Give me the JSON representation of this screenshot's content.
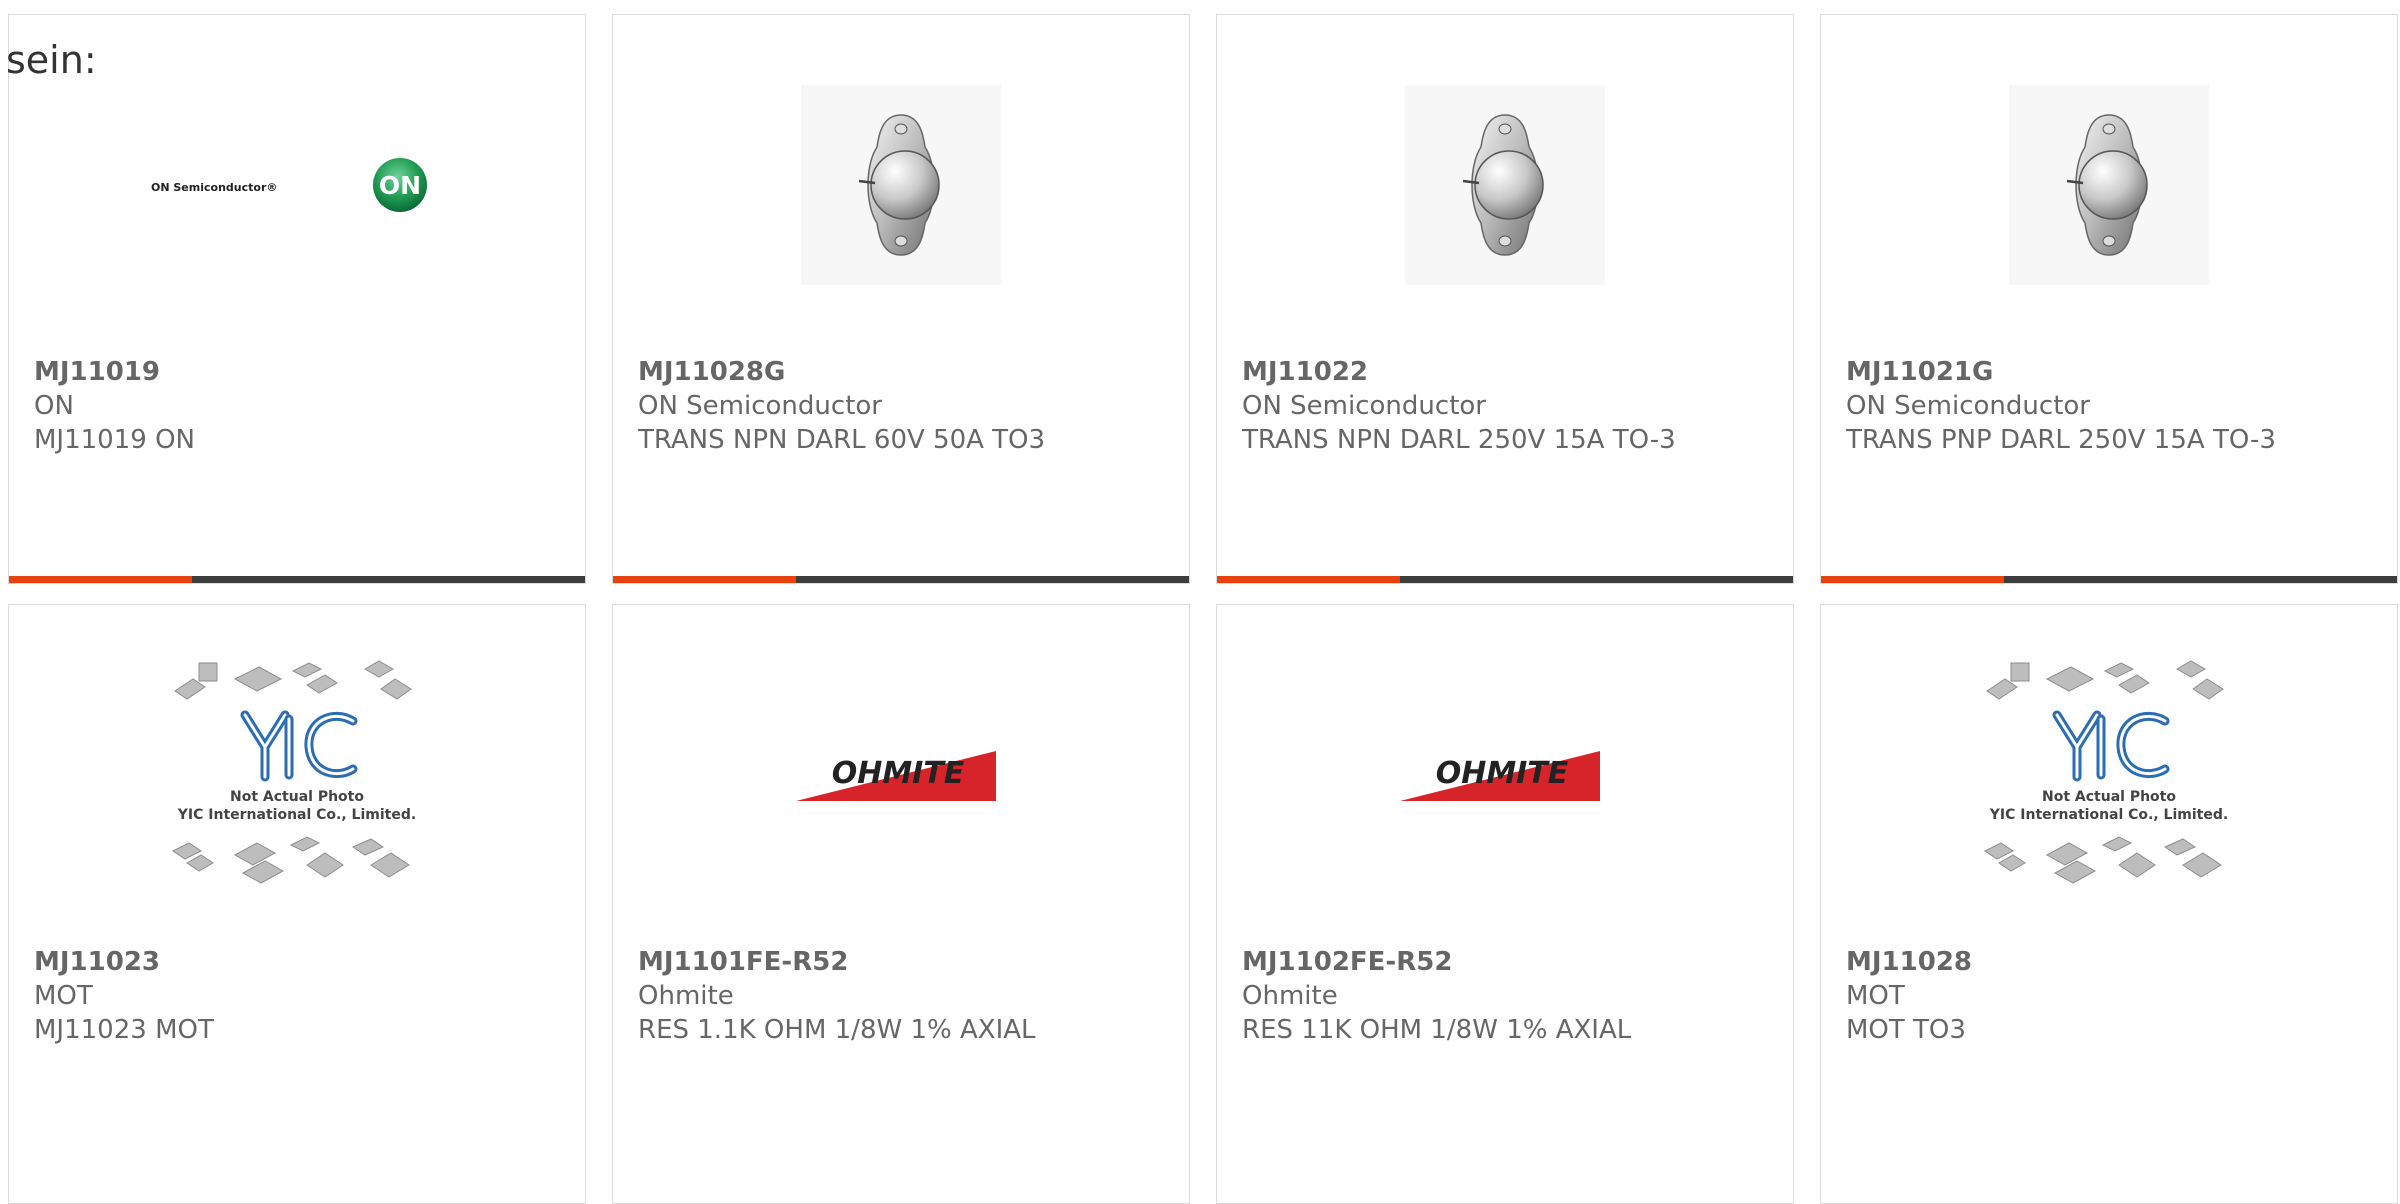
{
  "leftover_text": "sein:",
  "colors": {
    "accent": "#e8430f",
    "bar": "#3d3d3d",
    "border": "#dcdcdc",
    "text": "#666666"
  },
  "products": [
    {
      "part": "MJ11019",
      "manufacturer": "ON",
      "description": "MJ11019 ON",
      "image": "on-semiconductor-logo",
      "logo_text": "ON Semiconductor®",
      "badge_text": "ON"
    },
    {
      "part": "MJ11028G",
      "manufacturer": "ON Semiconductor",
      "description": "TRANS NPN DARL 60V 50A TO3",
      "image": "to3-transistor-photo"
    },
    {
      "part": "MJ11022",
      "manufacturer": "ON Semiconductor",
      "description": "TRANS NPN DARL 250V 15A TO-3",
      "image": "to3-transistor-photo"
    },
    {
      "part": "MJ11021G",
      "manufacturer": "ON Semiconductor",
      "description": "TRANS PNP DARL 250V 15A TO-3",
      "image": "to3-transistor-photo"
    },
    {
      "part": "MJ11023",
      "manufacturer": "MOT",
      "description": "MJ11023 MOT",
      "image": "yic-placeholder",
      "placeholder_line1": "Not Actual Photo",
      "placeholder_line2": "YIC International Co., Limited."
    },
    {
      "part": "MJ1101FE-R52",
      "manufacturer": "Ohmite",
      "description": "RES 1.1K OHM 1/8W 1% AXIAL",
      "image": "ohmite-logo",
      "logo_text": "OHMITE"
    },
    {
      "part": "MJ1102FE-R52",
      "manufacturer": "Ohmite",
      "description": "RES 11K OHM 1/8W 1% AXIAL",
      "image": "ohmite-logo",
      "logo_text": "OHMITE"
    },
    {
      "part": "MJ11028",
      "manufacturer": "MOT",
      "description": "MOT TO3",
      "image": "yic-placeholder",
      "placeholder_line1": "Not Actual Photo",
      "placeholder_line2": "YIC International Co., Limited."
    }
  ]
}
